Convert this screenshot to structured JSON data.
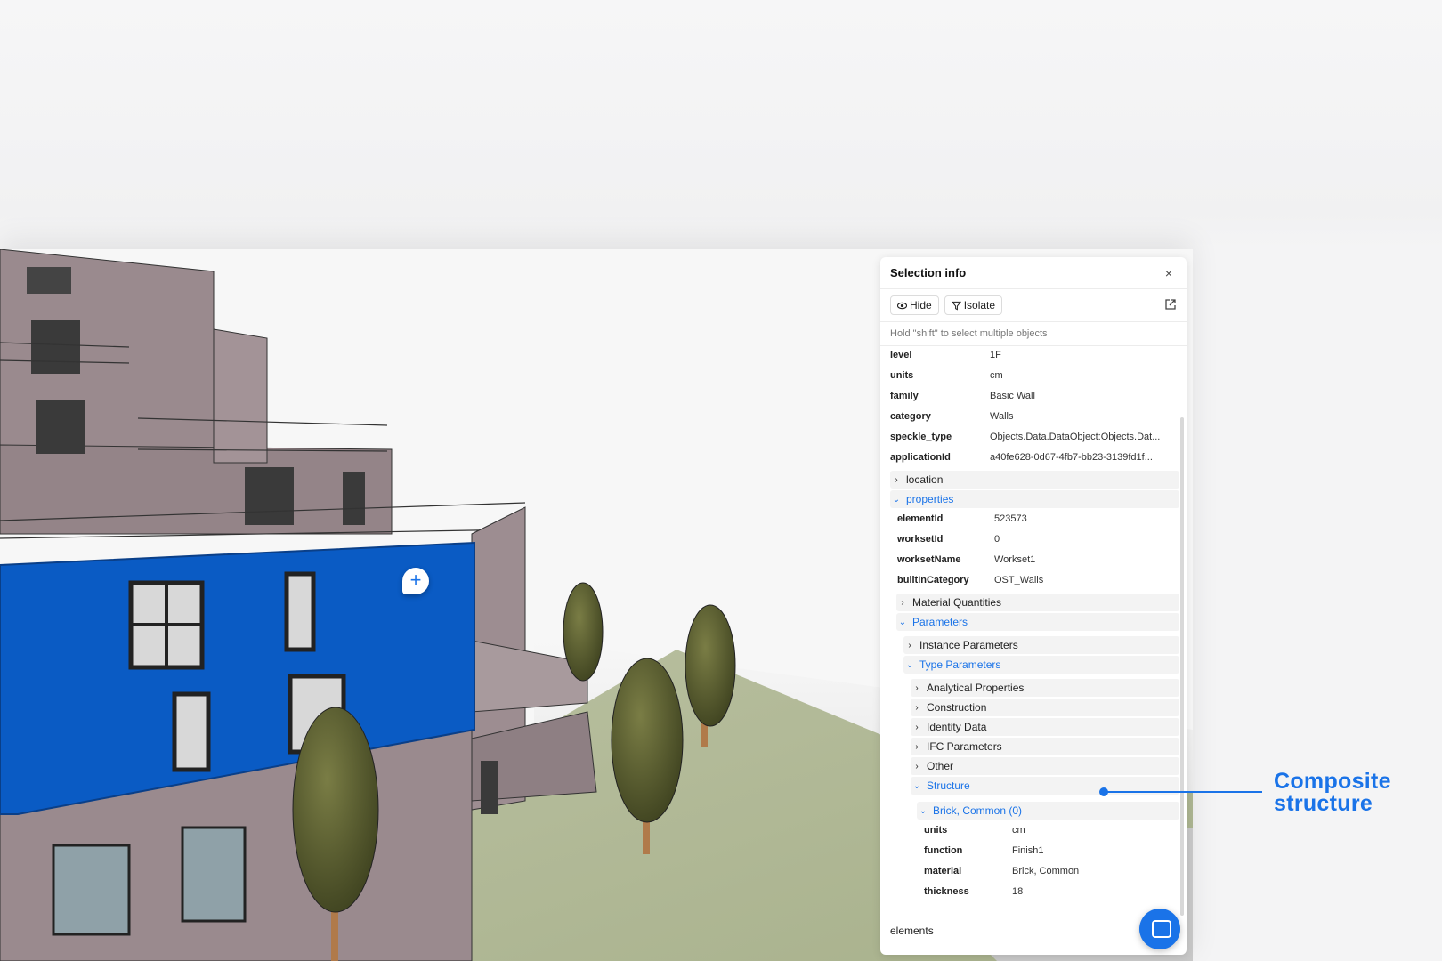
{
  "panel": {
    "title": "Selection info",
    "close_icon": "×",
    "hide_label": "Hide",
    "isolate_label": "Isolate",
    "hint": "Hold \"shift\" to select multiple objects",
    "top_props": [
      {
        "key": "level",
        "value": "1F"
      },
      {
        "key": "units",
        "value": "cm"
      },
      {
        "key": "family",
        "value": "Basic Wall"
      },
      {
        "key": "category",
        "value": "Walls"
      },
      {
        "key": "speckle_type",
        "value": "Objects.Data.DataObject:Objects.Dat..."
      },
      {
        "key": "applicationId",
        "value": "a40fe628-0d67-4fb7-bb23-3139fd1f..."
      }
    ],
    "location_label": "location",
    "properties_label": "properties",
    "properties": [
      {
        "key": "elementId",
        "value": "523573"
      },
      {
        "key": "worksetId",
        "value": "0"
      },
      {
        "key": "worksetName",
        "value": "Workset1"
      },
      {
        "key": "builtInCategory",
        "value": "OST_Walls"
      }
    ],
    "material_quantities_label": "Material Quantities",
    "parameters_label": "Parameters",
    "instance_parameters_label": "Instance Parameters",
    "type_parameters_label": "Type Parameters",
    "type_groups": [
      "Analytical Properties",
      "Construction",
      "Identity Data",
      "IFC Parameters",
      "Other"
    ],
    "structure_label": "Structure",
    "brick_label": "Brick, Common (0)",
    "brick_props": [
      {
        "key": "units",
        "value": "cm"
      },
      {
        "key": "function",
        "value": "Finish1"
      },
      {
        "key": "material",
        "value": "Brick, Common"
      },
      {
        "key": "thickness",
        "value": "18"
      }
    ],
    "elements_label": "elements"
  },
  "callout": {
    "line1": "Composite",
    "line2": "structure"
  },
  "icons": {
    "hide": "eye-icon",
    "isolate": "filter-icon",
    "open_external": "external-link-icon",
    "chat": "chat-icon",
    "comment": "plus-icon"
  },
  "colors": {
    "accent": "#1a73e8",
    "selection": "#0a5bc4"
  }
}
